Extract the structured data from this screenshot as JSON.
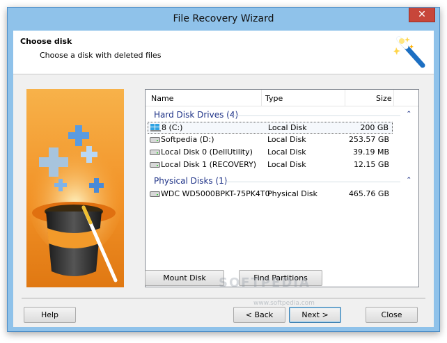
{
  "window": {
    "title": "File Recovery Wizard",
    "close_glyph": "✕"
  },
  "header": {
    "title": "Choose disk",
    "subtitle": "Choose a disk with deleted files"
  },
  "list": {
    "columns": {
      "name": "Name",
      "type": "Type",
      "size": "Size"
    },
    "groups": [
      {
        "label": "Hard Disk Drives (4)",
        "collapse_glyph": "⌃",
        "rows": [
          {
            "name": "8 (C:)",
            "type": "Local Disk",
            "size": "200 GB",
            "icon": "windows-drive-icon",
            "selected": true
          },
          {
            "name": "Softpedia (D:)",
            "type": "Local Disk",
            "size": "253.57 GB",
            "icon": "hard-drive-icon"
          },
          {
            "name": "Local Disk 0 (DellUtility)",
            "type": "Local Disk",
            "size": "39.19 MB",
            "icon": "hard-drive-icon"
          },
          {
            "name": "Local Disk 1 (RECOVERY)",
            "type": "Local Disk",
            "size": "12.15 GB",
            "icon": "hard-drive-icon"
          }
        ]
      },
      {
        "label": "Physical Disks (1)",
        "collapse_glyph": "⌃",
        "rows": [
          {
            "name": "WDC WD5000BPKT-75PK4T0",
            "type": "Physical Disk",
            "size": "465.76 GB",
            "icon": "hard-drive-icon"
          }
        ]
      }
    ]
  },
  "buttons": {
    "mount": "Mount Disk",
    "find": "Find Partitions",
    "help": "Help",
    "back": "< Back",
    "next": "Next >",
    "close": "Close"
  },
  "watermark": {
    "main": "SOFTPEDIA",
    "sub": "www.softpedia.com"
  },
  "colors": {
    "titlebar": "#8fc2ea",
    "close": "#c7463a",
    "group_text": "#1e3287",
    "accent_orange": "#f39a2a"
  }
}
